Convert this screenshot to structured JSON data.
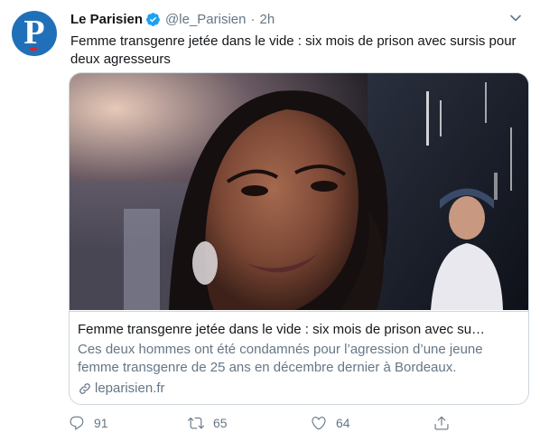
{
  "tweet": {
    "author_name": "Le Parisien",
    "handle": "@le_Parisien",
    "separator": "·",
    "time": "2h",
    "avatar_letter": "P",
    "text": "Femme transgenre jetée dans le vide : six mois de prison avec sursis pour deux agresseurs"
  },
  "card": {
    "title": "Femme transgenre jetée dans le vide : six mois de prison avec su…",
    "description": "Ces deux hommes ont été condamnés pour l’agression d’une jeune femme transgenre de 25 ans en décembre dernier à Bordeaux.",
    "domain": "leparisien.fr",
    "image_icon": "photo-of-woman"
  },
  "actions": {
    "reply_count": "91",
    "retweet_count": "65",
    "like_count": "64"
  },
  "colors": {
    "accent": "#1da1f2",
    "muted": "#657786",
    "text": "#14171a",
    "border": "#ccd6dd",
    "brand": "#1f6fb9"
  }
}
